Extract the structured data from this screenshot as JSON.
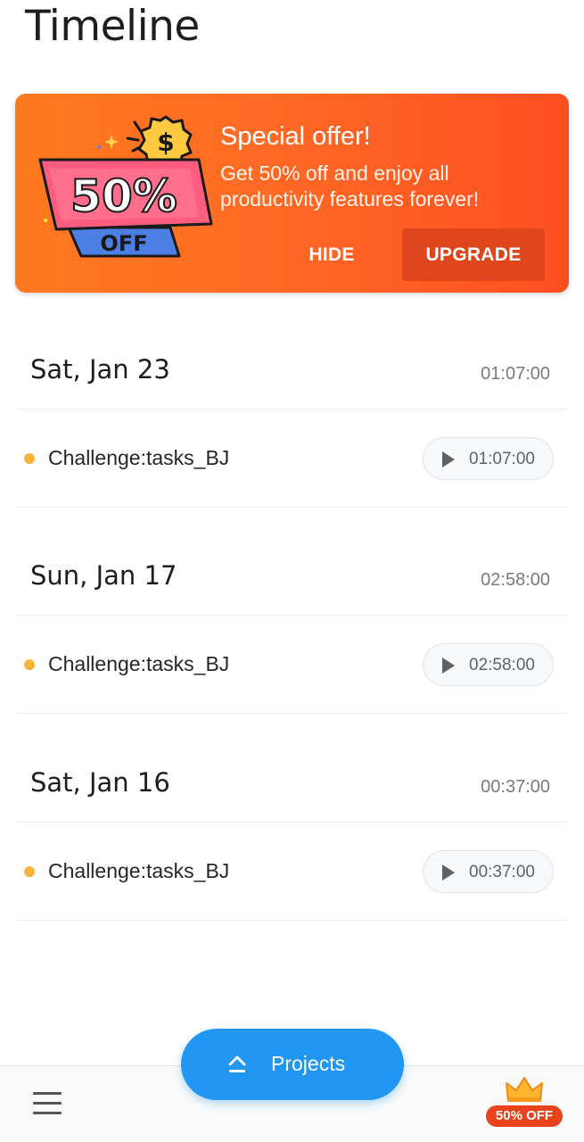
{
  "page": {
    "title": "Timeline"
  },
  "promo": {
    "art_percent": "50%",
    "art_off": "OFF",
    "title": "Special offer!",
    "body": "Get 50% off and enjoy all productivity features forever!",
    "hide_label": "HIDE",
    "upgrade_label": "UPGRADE",
    "colors": {
      "gradient_start": "#ff7a1f",
      "gradient_end": "#ff4f22",
      "upgrade_bg": "#e0461d"
    }
  },
  "days": [
    {
      "date": "Sat, Jan 23",
      "total": "01:07:00",
      "entries": [
        {
          "name": "Challenge:tasks_BJ",
          "duration": "01:07:00",
          "color": "#f6b43a",
          "icon": "play-icon"
        }
      ]
    },
    {
      "date": "Sun, Jan 17",
      "total": "02:58:00",
      "entries": [
        {
          "name": "Challenge:tasks_BJ",
          "duration": "02:58:00",
          "color": "#f6b43a",
          "icon": "play-icon"
        }
      ]
    },
    {
      "date": "Sat, Jan 16",
      "total": "00:37:00",
      "entries": [
        {
          "name": "Challenge:tasks_BJ",
          "duration": "00:37:00",
          "color": "#f6b43a",
          "icon": "play-icon"
        }
      ]
    }
  ],
  "fab": {
    "label": "Projects",
    "icon": "chevron-up-icon",
    "color": "#2196f3"
  },
  "bottom_bar": {
    "menu_icon": "hamburger-menu-icon",
    "badge_icon": "crown-icon",
    "badge_label": "50% OFF",
    "badge_color": "#e8431c"
  }
}
